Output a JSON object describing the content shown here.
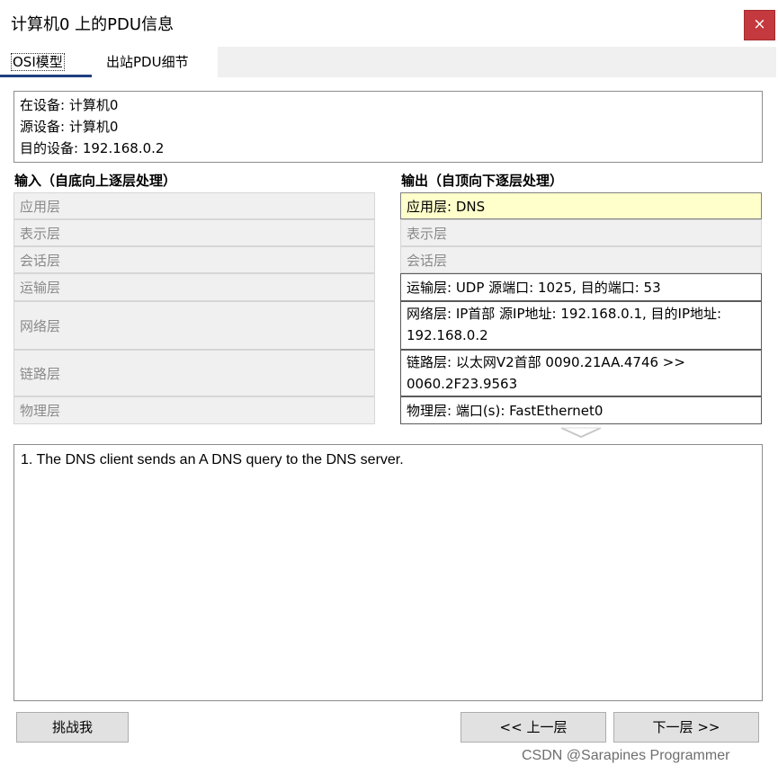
{
  "window": {
    "title": "计算机0 上的PDU信息",
    "close_label": "×"
  },
  "tabs": [
    {
      "label": "OSI模型",
      "active": true
    },
    {
      "label": "出站PDU细节",
      "active": false
    }
  ],
  "device_info": {
    "at_device": "在设备: 计算机0",
    "source_device": "源设备: 计算机0",
    "dest_device": "目的设备: 192.168.0.2"
  },
  "inbound": {
    "heading": "输入（自底向上逐层处理）",
    "layers": [
      "应用层",
      "表示层",
      "会话层",
      "运输层",
      "网络层",
      "链路层",
      "物理层"
    ]
  },
  "outbound": {
    "heading": "输出（自顶向下逐层处理）",
    "layers": [
      "应用层: DNS",
      "表示层",
      "会话层",
      "运输层: UDP 源端口: 1025, 目的端口: 53",
      "网络层: IP首部 源IP地址: 192.168.0.1, 目的IP地址: 192.168.0.2",
      "链路层: 以太网V2首部 0090.21AA.4746 >> 0060.2F23.9563",
      "物理层: 端口(s): FastEthernet0"
    ]
  },
  "description": "1. The DNS client sends an A DNS query to the DNS server.",
  "buttons": {
    "challenge": "挑战我",
    "previous": "<< 上一层",
    "next": "下一层 >>"
  },
  "watermark": "CSDN @Sarapines Programmer",
  "colors": {
    "close_button": "#c4393d",
    "selected_layer": "#ffffcc",
    "active_tab_underline": "#1f3f7f"
  }
}
